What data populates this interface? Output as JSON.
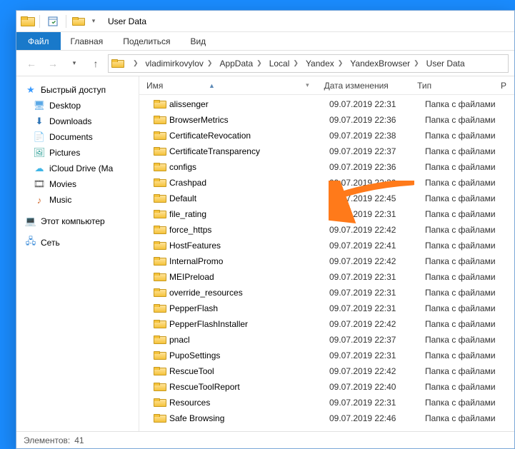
{
  "titlebar": {
    "title": "User Data"
  },
  "menu": {
    "file": "Файл",
    "tabs": [
      "Главная",
      "Поделиться",
      "Вид"
    ]
  },
  "breadcrumb": [
    "vladimirkovylov",
    "AppData",
    "Local",
    "Yandex",
    "YandexBrowser",
    "User Data"
  ],
  "columns": {
    "name": "Имя",
    "date": "Дата изменения",
    "type": "Тип",
    "size": "Р"
  },
  "sidebar": {
    "quick": {
      "label": "Быстрый доступ"
    },
    "desktop": {
      "label": "Desktop"
    },
    "downloads": {
      "label": "Downloads"
    },
    "documents": {
      "label": "Documents"
    },
    "pictures": {
      "label": "Pictures"
    },
    "icloud": {
      "label": "iCloud Drive (Ma"
    },
    "movies": {
      "label": "Movies"
    },
    "music": {
      "label": "Music"
    },
    "thispc": {
      "label": "Этот компьютер"
    },
    "network": {
      "label": "Сеть"
    }
  },
  "files": [
    {
      "name": "alissenger",
      "date": "09.07.2019 22:31",
      "type": "Папка с файлами"
    },
    {
      "name": "BrowserMetrics",
      "date": "09.07.2019 22:36",
      "type": "Папка с файлами"
    },
    {
      "name": "CertificateRevocation",
      "date": "09.07.2019 22:38",
      "type": "Папка с файлами"
    },
    {
      "name": "CertificateTransparency",
      "date": "09.07.2019 22:37",
      "type": "Папка с файлами"
    },
    {
      "name": "configs",
      "date": "09.07.2019 22:36",
      "type": "Папка с файлами"
    },
    {
      "name": "Crashpad",
      "date": "09.07.2019 22:30",
      "type": "Папка с файлами"
    },
    {
      "name": "Default",
      "date": "09.07.2019 22:45",
      "type": "Папка с файлами"
    },
    {
      "name": "file_rating",
      "date": "09.07.2019 22:31",
      "type": "Папка с файлами"
    },
    {
      "name": "force_https",
      "date": "09.07.2019 22:42",
      "type": "Папка с файлами"
    },
    {
      "name": "HostFeatures",
      "date": "09.07.2019 22:41",
      "type": "Папка с файлами"
    },
    {
      "name": "InternalPromo",
      "date": "09.07.2019 22:42",
      "type": "Папка с файлами"
    },
    {
      "name": "MEIPreload",
      "date": "09.07.2019 22:31",
      "type": "Папка с файлами"
    },
    {
      "name": "override_resources",
      "date": "09.07.2019 22:31",
      "type": "Папка с файлами"
    },
    {
      "name": "PepperFlash",
      "date": "09.07.2019 22:31",
      "type": "Папка с файлами"
    },
    {
      "name": "PepperFlashInstaller",
      "date": "09.07.2019 22:42",
      "type": "Папка с файлами"
    },
    {
      "name": "pnacl",
      "date": "09.07.2019 22:37",
      "type": "Папка с файлами"
    },
    {
      "name": "PupoSettings",
      "date": "09.07.2019 22:31",
      "type": "Папка с файлами"
    },
    {
      "name": "RescueTool",
      "date": "09.07.2019 22:42",
      "type": "Папка с файлами"
    },
    {
      "name": "RescueToolReport",
      "date": "09.07.2019 22:40",
      "type": "Папка с файлами"
    },
    {
      "name": "Resources",
      "date": "09.07.2019 22:31",
      "type": "Папка с файлами"
    },
    {
      "name": "Safe Browsing",
      "date": "09.07.2019 22:46",
      "type": "Папка с файлами"
    }
  ],
  "status": {
    "label": "Элементов:",
    "count": "41"
  }
}
